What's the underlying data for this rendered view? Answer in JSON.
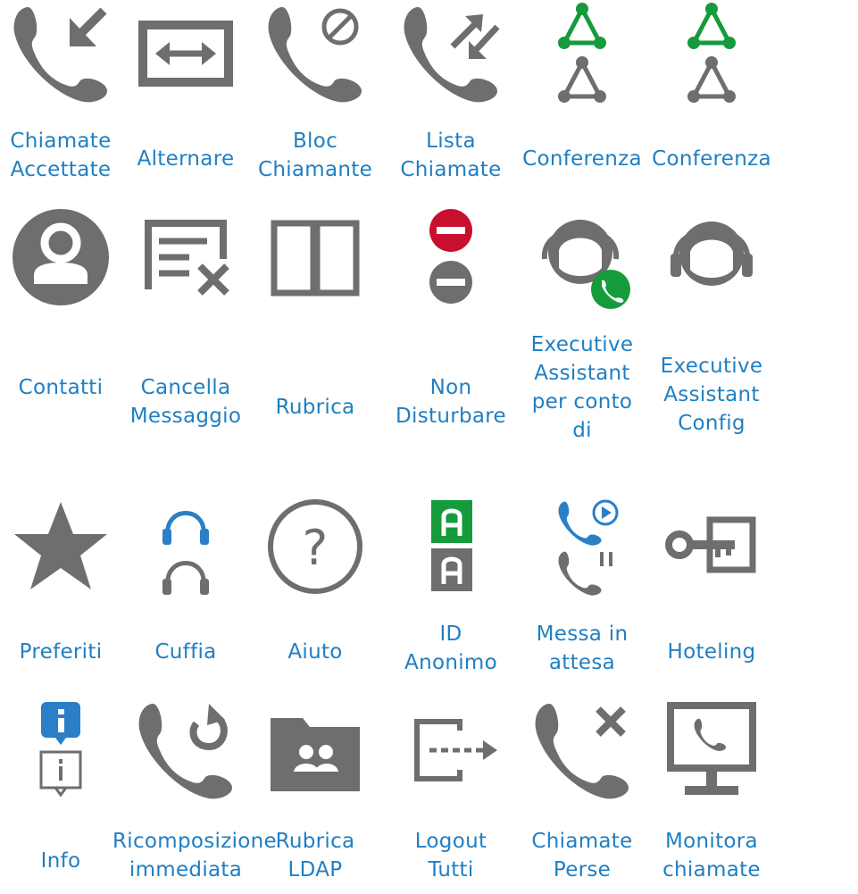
{
  "colors": {
    "label": "#1f7fc3",
    "icon_gray": "#6e6e6e",
    "green": "#159a3c",
    "red": "#c8102e",
    "blue": "#2a7fc7"
  },
  "rows": [
    [
      {
        "icon": "call-received-icon",
        "label_lines": [
          "Chiamate",
          "Accettate"
        ]
      },
      {
        "icon": "swap-icon",
        "label_lines": [
          "Alternare"
        ]
      },
      {
        "icon": "call-block-icon",
        "label_lines": [
          "Bloc",
          "Chiamante"
        ]
      },
      {
        "icon": "call-list-icon",
        "label_lines": [
          "Lista",
          "Chiamate"
        ]
      },
      {
        "icon": "conference-active-icon",
        "label_lines": [
          "Conferenza"
        ]
      },
      {
        "icon": "conference-icon",
        "label_lines": [
          "Conferenza"
        ]
      }
    ],
    [
      {
        "icon": "contact-icon",
        "label_lines": [
          "Contatti"
        ]
      },
      {
        "icon": "delete-message-icon",
        "label_lines": [
          "Cancella",
          "Messaggio"
        ]
      },
      {
        "icon": "phonebook-icon",
        "label_lines": [
          "Rubrica"
        ]
      },
      {
        "icon": "do-not-disturb-icon",
        "label_lines": [
          "Non",
          "Disturbare"
        ]
      },
      {
        "icon": "executive-assistant-call-icon",
        "label_lines": [
          "Executive",
          "Assistant",
          "per conto",
          "di"
        ]
      },
      {
        "icon": "executive-assistant-icon",
        "label_lines": [
          "Executive",
          "Assistant",
          "Config"
        ]
      }
    ],
    [
      {
        "icon": "star-icon",
        "label_lines": [
          "Preferiti"
        ]
      },
      {
        "icon": "headset-icon",
        "label_lines": [
          "Cuffia"
        ]
      },
      {
        "icon": "help-icon",
        "label_lines": [
          "Aiuto"
        ]
      },
      {
        "icon": "anonymous-id-icon",
        "label_lines": [
          "ID",
          "Anonimo"
        ]
      },
      {
        "icon": "call-hold-icon",
        "label_lines": [
          "Messa in",
          "attesa"
        ]
      },
      {
        "icon": "key-icon",
        "label_lines": [
          "Hoteling"
        ]
      }
    ],
    [
      {
        "icon": "info-icon",
        "label_lines": [
          "Info"
        ]
      },
      {
        "icon": "redial-icon",
        "label_lines": [
          "Ricomposizione",
          "immediata"
        ]
      },
      {
        "icon": "ldap-folder-icon",
        "label_lines": [
          "Rubrica",
          "LDAP"
        ]
      },
      {
        "icon": "logout-icon",
        "label_lines": [
          "Logout",
          "Tutti"
        ]
      },
      {
        "icon": "missed-call-icon",
        "label_lines": [
          "Chiamate",
          "Perse"
        ]
      },
      {
        "icon": "monitor-call-icon",
        "label_lines": [
          "Monitora",
          "chiamate"
        ]
      }
    ]
  ]
}
